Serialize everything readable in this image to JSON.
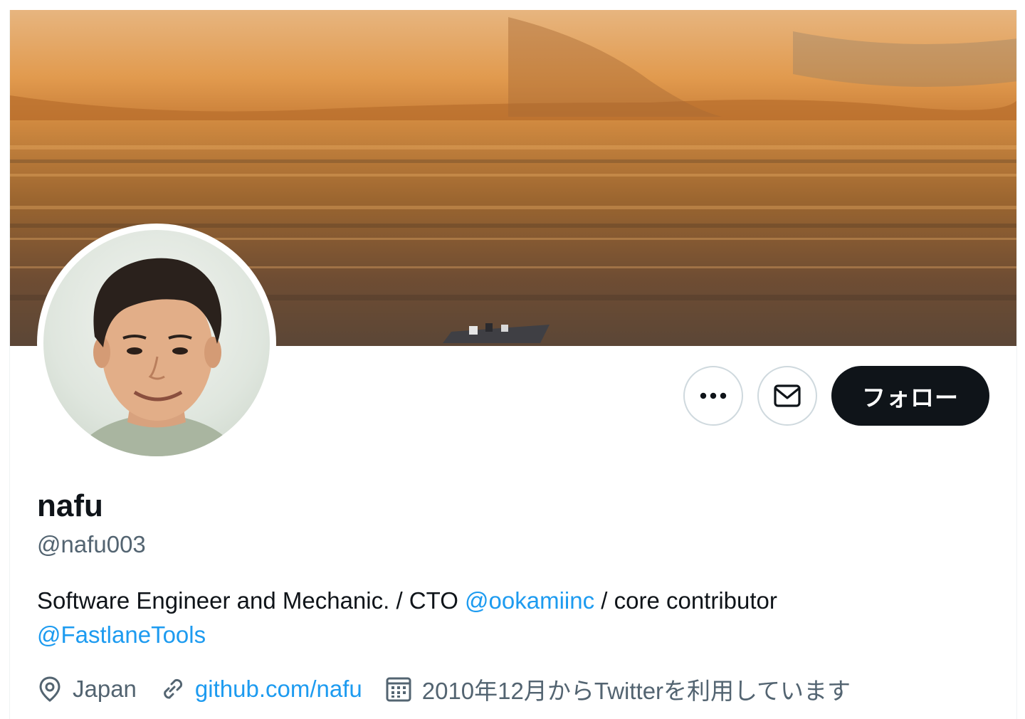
{
  "profile": {
    "display_name": "nafu",
    "handle": "@nafu003",
    "bio": {
      "text_1": "Software Engineer and Mechanic. / CTO ",
      "mention_1": "@ookamiinc",
      "text_2": " / core contributor",
      "mention_2": "@FastlaneTools"
    },
    "location": "Japan",
    "website": "github.com/nafu",
    "joined": "2010年12月からTwitterを利用しています"
  },
  "actions": {
    "more_icon": "more-horizontal-icon",
    "message_icon": "envelope-icon",
    "follow_label": "フォロー"
  },
  "icons": {
    "location": "location-pin-icon",
    "link": "link-icon",
    "calendar": "calendar-icon"
  },
  "colors": {
    "accent": "#1d9bf0",
    "text_primary": "#0f1419",
    "text_secondary": "#536471",
    "button_dark": "#0f1419",
    "border": "#cfd9de"
  }
}
